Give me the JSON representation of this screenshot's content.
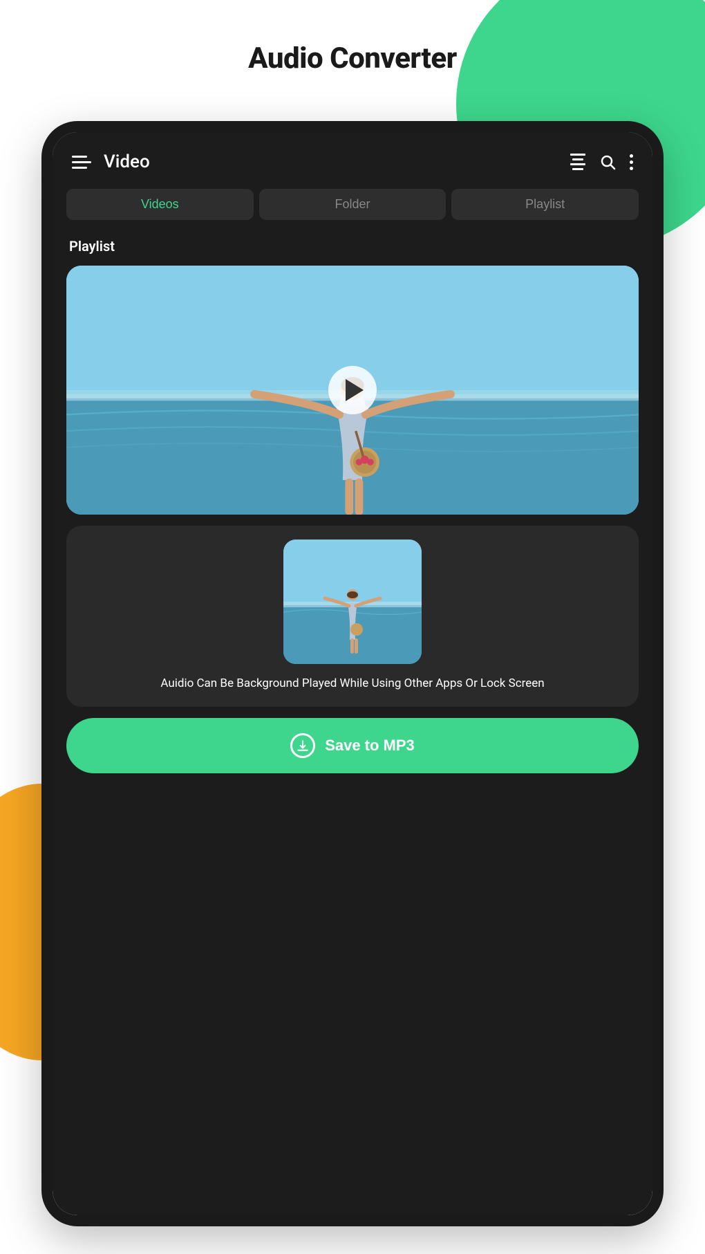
{
  "page": {
    "title": "Audio Converter"
  },
  "app": {
    "title": "Video",
    "tabs": [
      {
        "id": "videos",
        "label": "Videos",
        "active": true
      },
      {
        "id": "folder",
        "label": "Folder",
        "active": false
      },
      {
        "id": "playlist",
        "label": "Playlist",
        "active": false
      }
    ],
    "section_label": "Playlist",
    "second_video_text": "Auidio Can Be Background Played While Using Other Apps Or Lock Screen",
    "save_button_label": "Save to MP3"
  }
}
